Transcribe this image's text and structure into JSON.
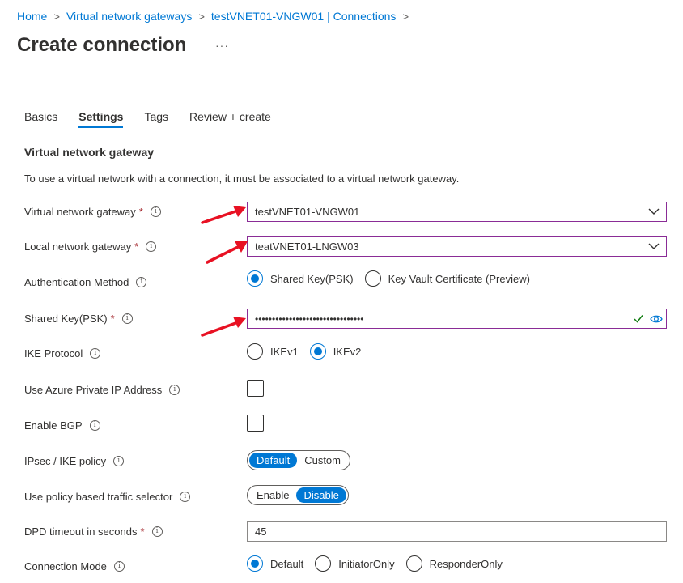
{
  "breadcrumb": {
    "items": [
      "Home",
      "Virtual network gateways",
      "testVNET01-VNGW01 | Connections"
    ],
    "separator": ">"
  },
  "page": {
    "title": "Create connection",
    "more": "···"
  },
  "tabs": [
    "Basics",
    "Settings",
    "Tags",
    "Review + create"
  ],
  "active_tab": "Settings",
  "section": {
    "title": "Virtual network gateway",
    "description": "To use a virtual network with a connection, it must be associated to a virtual network gateway."
  },
  "fields": {
    "vng": {
      "label": "Virtual network gateway",
      "required": "*",
      "value": "testVNET01-VNGW01"
    },
    "lng": {
      "label": "Local network gateway",
      "required": "*",
      "value": "teatVNET01-LNGW03"
    },
    "auth": {
      "label": "Authentication Method",
      "options": [
        "Shared Key(PSK)",
        "Key Vault Certificate (Preview)"
      ],
      "selected": "Shared Key(PSK)"
    },
    "psk": {
      "label": "Shared Key(PSK)",
      "required": "*",
      "masked_value": "••••••••••••••••••••••••••••••••"
    },
    "ike": {
      "label": "IKE Protocol",
      "options": [
        "IKEv1",
        "IKEv2"
      ],
      "selected": "IKEv2"
    },
    "private_ip": {
      "label": "Use Azure Private IP Address",
      "checked": false
    },
    "bgp": {
      "label": "Enable BGP",
      "checked": false
    },
    "ipsec": {
      "label": "IPsec / IKE policy",
      "options": [
        "Default",
        "Custom"
      ],
      "selected": "Default"
    },
    "policy_selector": {
      "label": "Use policy based traffic selector",
      "options": [
        "Enable",
        "Disable"
      ],
      "selected": "Disable"
    },
    "dpd": {
      "label": "DPD timeout in seconds",
      "required": "*",
      "value": "45"
    },
    "conn_mode": {
      "label": "Connection Mode",
      "options": [
        "Default",
        "InitiatorOnly",
        "ResponderOnly"
      ],
      "selected": "Default"
    }
  },
  "info_glyph": "i",
  "colors": {
    "link": "#0078d4",
    "accent": "#0078d4",
    "required": "#a4262c",
    "highlight_border": "#8a2c96",
    "annotation_arrow": "#e81123",
    "valid_check": "#107c10"
  }
}
